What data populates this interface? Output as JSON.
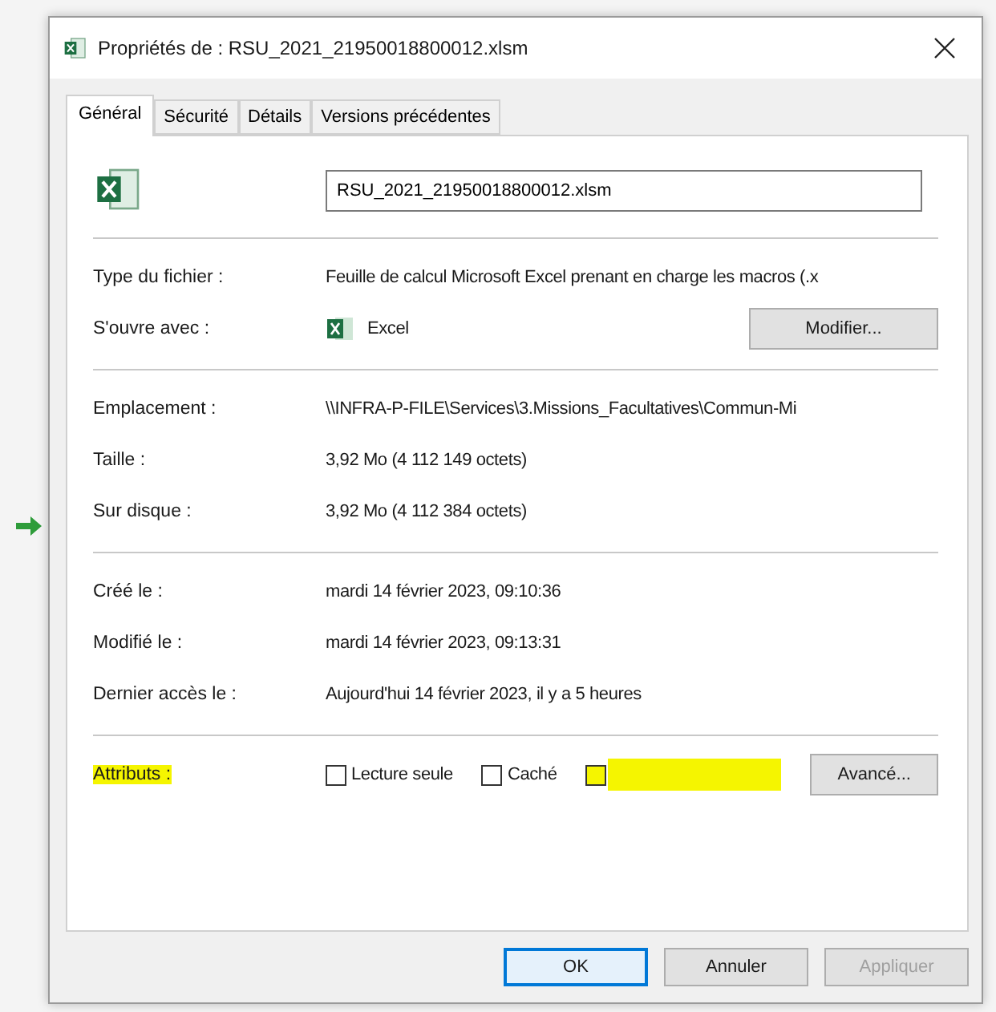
{
  "window": {
    "title": "Propriétés de : RSU_2021_21950018800012.xlsm"
  },
  "tabs": [
    {
      "label": "Général",
      "selected": true
    },
    {
      "label": "Sécurité",
      "selected": false
    },
    {
      "label": "Détails",
      "selected": false
    },
    {
      "label": "Versions précédentes",
      "selected": false
    }
  ],
  "file_name": "RSU_2021_21950018800012.xlsm",
  "sections": [
    {
      "rows": [
        {
          "label": "Type du fichier :",
          "value": "Feuille de calcul Microsoft Excel prenant en charge les macros (.x"
        },
        {
          "label": "S'ouvre avec :",
          "value": "Excel",
          "kind": "app",
          "button": "Modifier..."
        }
      ]
    },
    {
      "rows": [
        {
          "label": "Emplacement :",
          "value": "\\\\INFRA-P-FILE\\Services\\3.Missions_Facultatives\\Commun-Mi"
        },
        {
          "label": "Taille :",
          "value": "3,92 Mo (4 112 149 octets)"
        },
        {
          "label": "Sur disque :",
          "value": "3,92 Mo (4 112 384 octets)"
        }
      ]
    },
    {
      "rows": [
        {
          "label": "Créé le :",
          "value": "mardi 14 février 2023, 09:10:36"
        },
        {
          "label": "Modifié le :",
          "value": "mardi 14 février 2023, 09:13:31"
        },
        {
          "label": "Dernier accès le :",
          "value": "Aujourd'hui 14 février 2023, il y a 5 heures"
        }
      ]
    }
  ],
  "attributes": {
    "label": "Attributs :",
    "highlighted": true,
    "checkboxes": [
      {
        "label": "Lecture seule",
        "checked": false,
        "highlighted": false
      },
      {
        "label": "Caché",
        "checked": false,
        "highlighted": false
      },
      {
        "checked": false,
        "highlighted": true
      }
    ],
    "button": "Avancé..."
  },
  "buttons": [
    {
      "label": "OK",
      "default": true,
      "disabled": false
    },
    {
      "label": "Annuler",
      "default": false,
      "disabled": false
    },
    {
      "label": "Appliquer",
      "default": false,
      "disabled": true
    }
  ]
}
